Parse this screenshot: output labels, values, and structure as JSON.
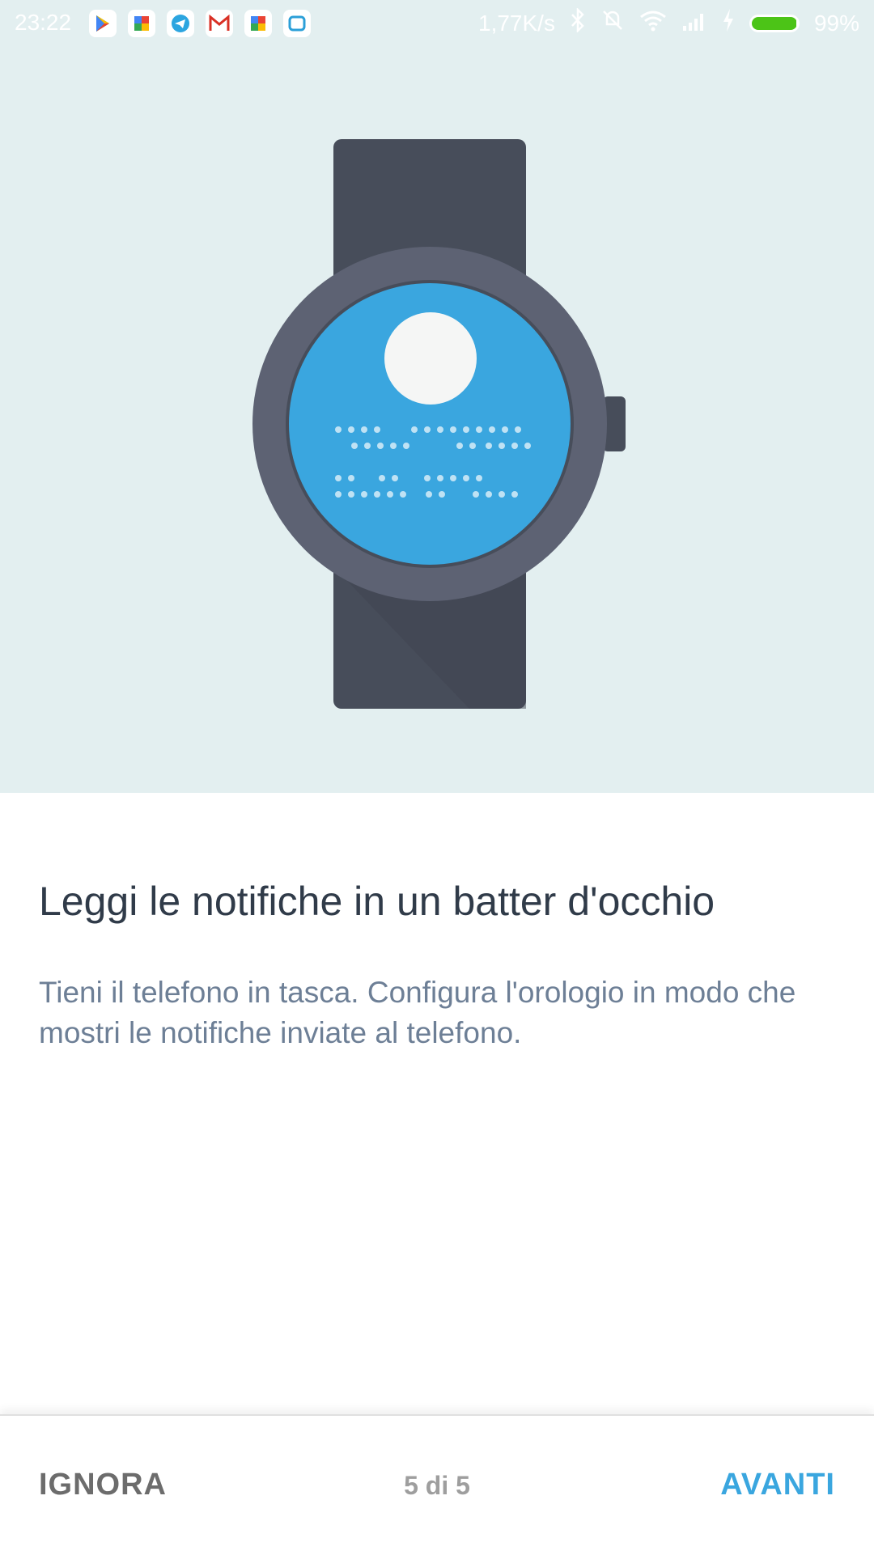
{
  "status_bar": {
    "time": "23:22",
    "network_speed": "1,77K/s",
    "battery_percent": "99%",
    "battery_level": 0.99,
    "notification_icons": [
      "play-store-icon",
      "puzzle-icon",
      "telegram-icon",
      "gmail-icon",
      "puzzle-icon",
      "screen-icon"
    ]
  },
  "content": {
    "title": "Leggi le notifiche in un batter d'occhio",
    "description": "Tieni il telefono in tasca. Configura l'orologio in modo che mostri le notifiche inviate al telefono."
  },
  "footer": {
    "skip_label": "IGNORA",
    "page_indicator": "5 di 5",
    "next_label": "AVANTI"
  },
  "colors": {
    "hero_background": "#e3eff0",
    "watch_band": "#474d5a",
    "watch_bezel": "#5d6273",
    "watch_screen": "#3aa6df",
    "accent": "#3aa6df",
    "title_text": "#303b49",
    "body_text": "#6d7f96"
  }
}
